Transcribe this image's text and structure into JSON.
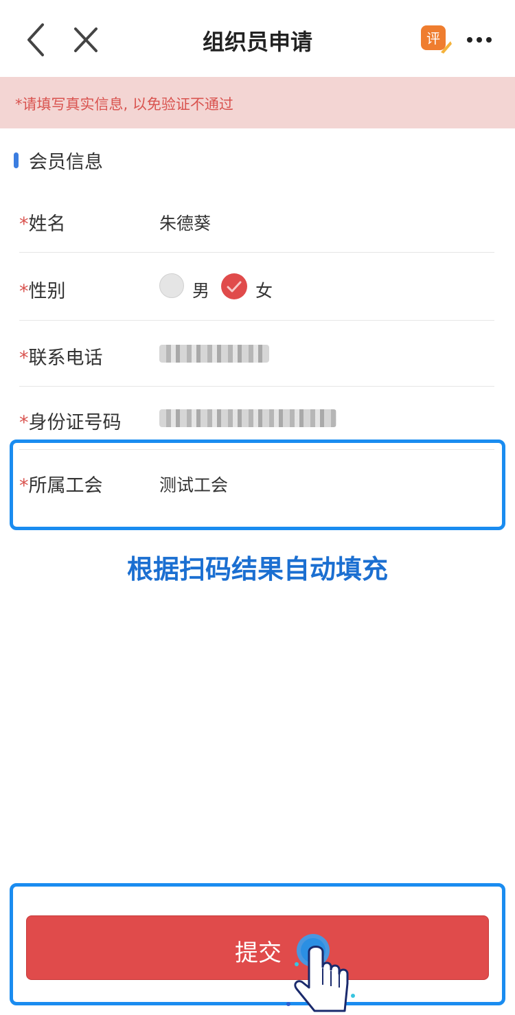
{
  "nav": {
    "title": "组织员申请",
    "rate_glyph": "评"
  },
  "notice": {
    "text": "*请填写真实信息, 以免验证不通过"
  },
  "section": {
    "title": "会员信息"
  },
  "form": {
    "name": {
      "required": "*",
      "label": "姓名",
      "value": "朱德葵"
    },
    "gender": {
      "required": "*",
      "label": "性别",
      "options": [
        "男",
        "女"
      ],
      "selected": "女"
    },
    "phone": {
      "required": "*",
      "label": "联系电话"
    },
    "id_number": {
      "required": "*",
      "label": "身份证号码"
    },
    "union": {
      "required": "*",
      "label": "所属工会",
      "value": "测试工会"
    }
  },
  "hint": {
    "text": "根据扫码结果自动填充"
  },
  "submit": {
    "label": "提交"
  },
  "colors": {
    "accent": "#e04b4b",
    "highlight": "#1a8cf0",
    "hint": "#1b6fd1",
    "notice_bg": "#f3d5d3"
  },
  "icons": [
    "back-arrow-icon",
    "close-icon",
    "rate-icon",
    "more-icon",
    "checkmark-icon",
    "tap-hand-icon"
  ]
}
